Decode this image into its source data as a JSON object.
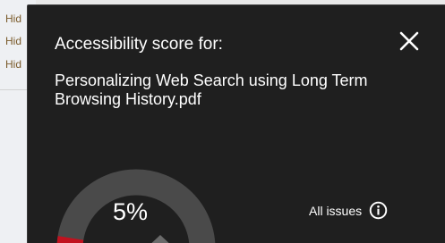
{
  "background": {
    "lines": [
      "Hid",
      "Hid",
      "Hid"
    ]
  },
  "dialog": {
    "heading": "Accessibility score for:",
    "file_name": "Personalizing Web Search using Long Term Browsing History.pdf",
    "close_icon": "close-icon",
    "score": {
      "label": "5%",
      "value": 0.05,
      "fill_color": "#c1121f",
      "track_color": "#4a4a4a"
    },
    "all_issues": {
      "label": "All issues",
      "icon": "info-icon"
    }
  }
}
